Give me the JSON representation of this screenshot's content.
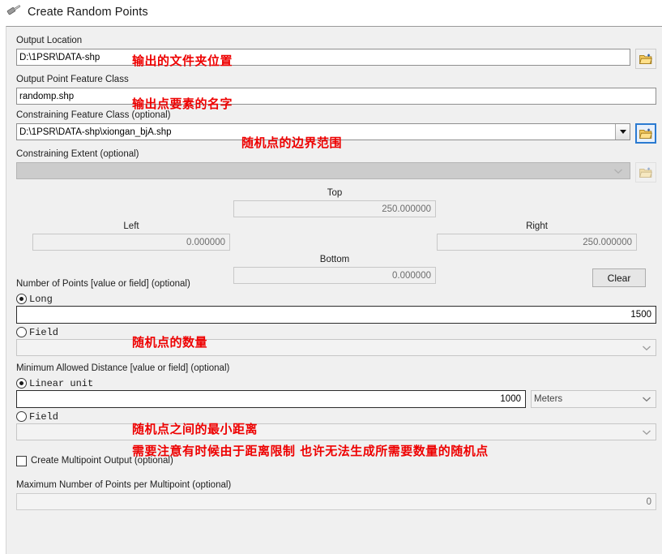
{
  "window": {
    "title": "Create Random Points",
    "tool_icon": "hammer-tool-icon"
  },
  "fields": {
    "output_location": {
      "label": "Output Location",
      "value": "D:\\1PSR\\DATA-shp",
      "browse_icon": "open-folder-icon"
    },
    "output_point_feature_class": {
      "label": "Output Point Feature Class",
      "value": "randomp.shp"
    },
    "constraining_feature_class": {
      "label": "Constraining Feature Class (optional)",
      "value": "D:\\1PSR\\DATA-shp\\xiongan_bjA.shp",
      "dropdown_icon": "chevron-down-icon",
      "browse_icon": "open-folder-icon"
    },
    "constraining_extent": {
      "label": "Constraining Extent (optional)",
      "value": "",
      "dropdown_icon": "chevron-down-icon",
      "browse_icon": "open-folder-icon"
    },
    "extent": {
      "top_label": "Top",
      "top_value": "250.000000",
      "left_label": "Left",
      "left_value": "0.000000",
      "right_label": "Right",
      "right_value": "250.000000",
      "bottom_label": "Bottom",
      "bottom_value": "0.000000",
      "clear_label": "Clear"
    },
    "number_of_points": {
      "label": "Number of Points [value or field] (optional)",
      "option_long": "Long",
      "option_field": "Field",
      "selected": "Long",
      "long_value": "1500",
      "field_value": ""
    },
    "minimum_allowed_distance": {
      "label": "Minimum Allowed Distance [value or field] (optional)",
      "option_linear_unit": "Linear unit",
      "option_field": "Field",
      "selected": "Linear unit",
      "linear_value": "1000",
      "unit_value": "Meters",
      "field_value": ""
    },
    "create_multipoint_output": {
      "label": "Create Multipoint Output (optional)",
      "checked": false
    },
    "max_points_per_multipoint": {
      "label": "Maximum Number of Points per Multipoint (optional)",
      "value": "0"
    }
  },
  "annotations": {
    "a1": "输出的文件夹位置",
    "a2": "输出点要素的名字",
    "a3": "随机点的边界范围",
    "a4": "随机点的数量",
    "a5": "随机点之间的最小距离",
    "a6": "需要注意有时候由于距离限制 也许无法生成所需要数量的随机点"
  },
  "colors": {
    "annotation_red": "#ee0000",
    "focus_blue": "#2a7ad1",
    "panel_bg": "#f0f0f0"
  }
}
